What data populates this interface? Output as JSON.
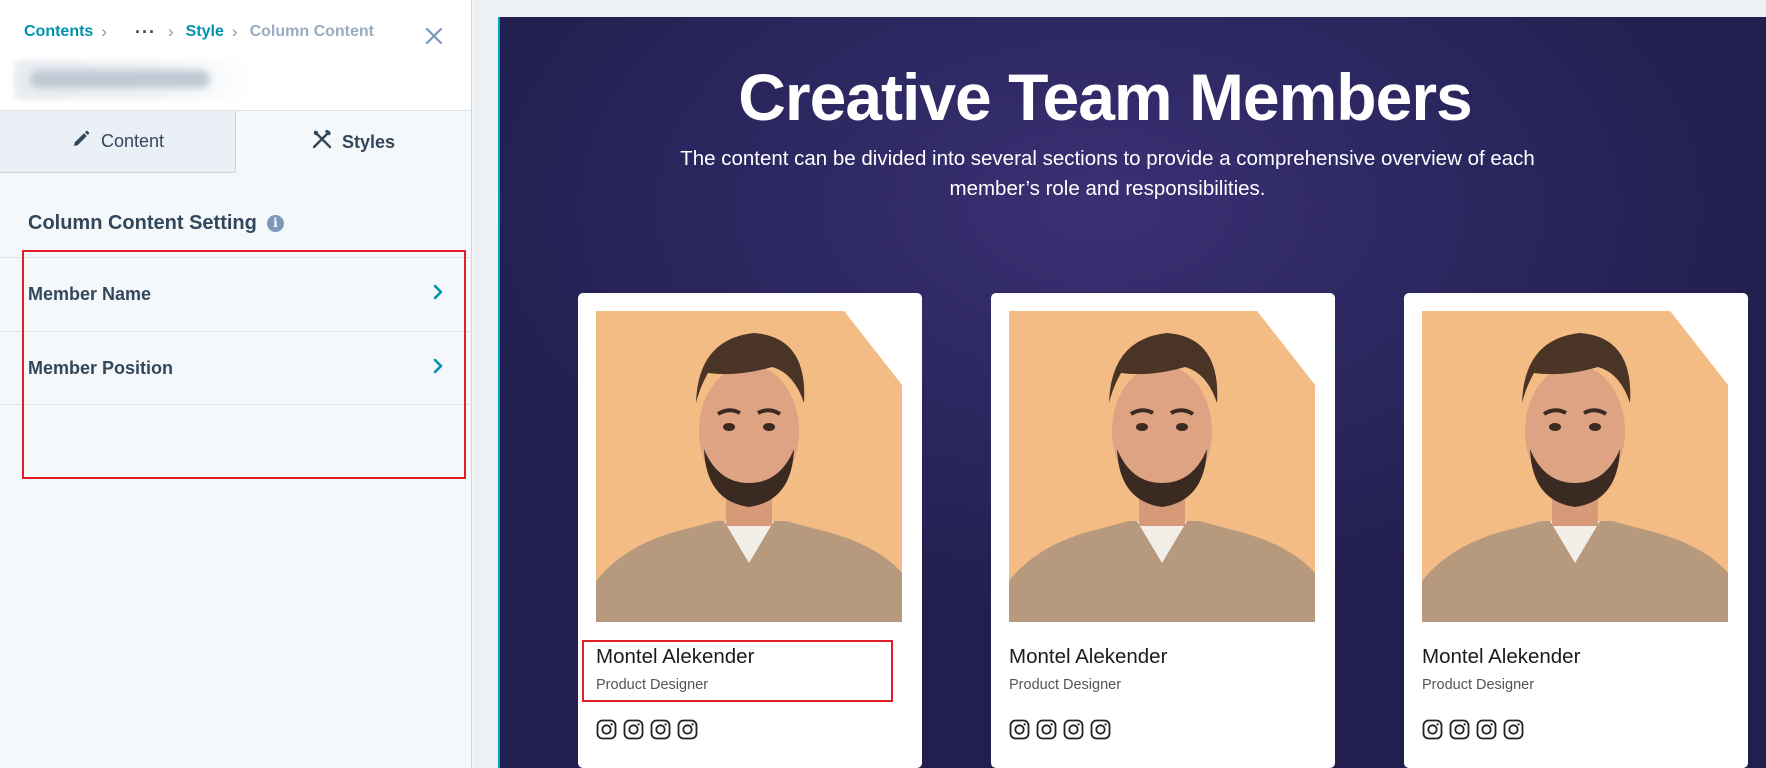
{
  "editor": {
    "breadcrumb": {
      "contents": "Contents",
      "more": "···",
      "style": "Style",
      "current": "Column Content"
    },
    "tabs": {
      "content_label": "Content",
      "styles_label": "Styles"
    },
    "section_title": "Column Content Setting",
    "settings": [
      {
        "label": "Member Name"
      },
      {
        "label": "Member Position"
      }
    ]
  },
  "preview": {
    "title": "Creative Team Members",
    "description": "The content can be divided into several sections to provide a comprehensive overview of each member’s role and responsibilities.",
    "members": [
      {
        "name": "Montel Alekender",
        "position": "Product Designer",
        "socials": [
          "instagram-icon",
          "instagram-icon",
          "instagram-icon",
          "instagram-icon"
        ]
      },
      {
        "name": "Montel Alekender",
        "position": "Product Designer",
        "socials": [
          "instagram-icon",
          "instagram-icon",
          "instagram-icon",
          "instagram-icon"
        ]
      },
      {
        "name": "Montel Alekender",
        "position": "Product Designer",
        "socials": [
          "instagram-icon",
          "instagram-icon",
          "instagram-icon",
          "instagram-icon"
        ]
      }
    ]
  },
  "colors": {
    "accent_link": "#0091ae",
    "text_dark": "#33475b",
    "stage_bg": "#2d2862",
    "highlight": "#e01f26",
    "photo_bg": "#f3bc84"
  }
}
